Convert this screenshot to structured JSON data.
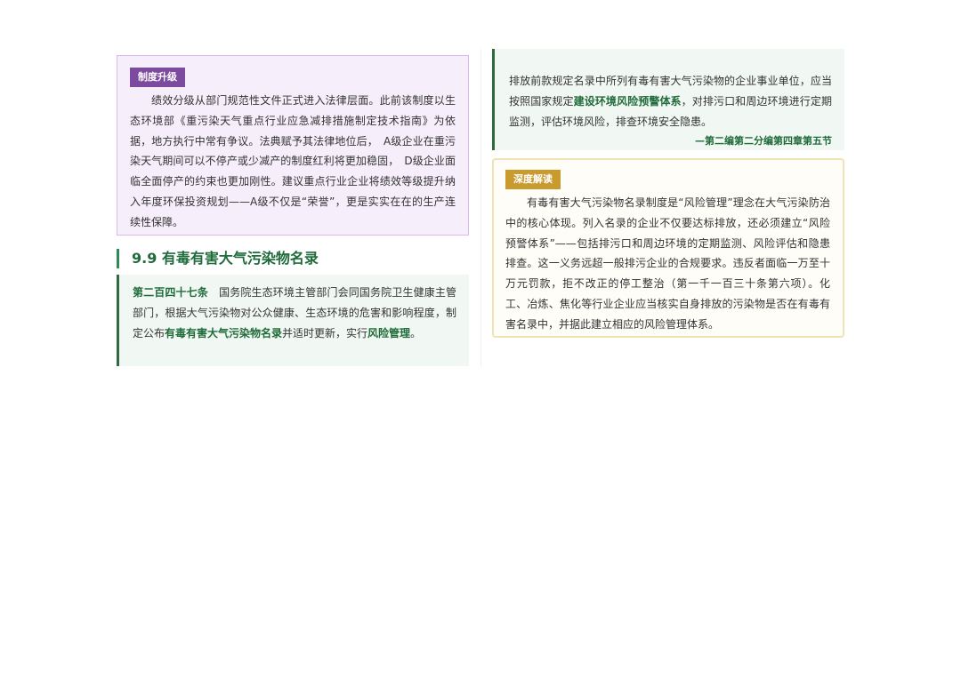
{
  "left": {
    "system_box": {
      "tag": "制度升级",
      "body": "绩效分级从部门规范性文件正式进入法律层面。此前该制度以生态环境部《重污染天气重点行业应急减排措施制定技术指南》为依据，地方执行中常有争议。法典赋予其法律地位后，　A级企业在重污染天气期间可以不停产或少减产的制度红利将更加稳固，　D级企业面临全面停产的约束也更加刚性。建议重点行业企业将绩效等级提升纳入年度环保投资规划——A级不仅是“荣誉”，更是实实在在的生产连续性保障。"
    },
    "section_heading": "9.9 有毒有害大气污染物名录",
    "article": {
      "number": "第二百四十七条",
      "text_before": "　国务院生态环境主管部门会同国务院卫生健康主管部门，根据大气污染物对公众健康、生态环境的危害和影响程度，制定公布",
      "highlight_1": "有毒有害大气污染物名录",
      "text_middle": "并适时更新，实行",
      "highlight_2": "风险管理",
      "text_end": "。"
    }
  },
  "right": {
    "quote": {
      "text_before": "排放前款规定名录中所列有毒有害大气污染物的企业事业单位，应当按照国家规定",
      "highlight": "建设环境风险预警体系",
      "text_after": "，对排污口和周边环境进行定期监测，评估环境风险，排查环境安全隐患。",
      "source": "—第二编第二分编第四章第五节"
    },
    "interpretation": {
      "tag": "深度解读",
      "body": "有毒有害大气污染物名录制度是“风险管理”理念在大气污染防治中的核心体现。列入名录的企业不仅要达标排放，还必须建立“风险预警体系”——包括排污口和周边环境的定期监测、风险评估和隐患排查。这一义务远超一般排污企业的合规要求。违反者面临一万至十万元罚款，拒不改正的停工整治（第一千一百三十条第六项）。化工、冶炼、焦化等行业企业应当核实自身排放的污染物是否在有毒有害名录中，并据此建立相应的风险管理体系。"
    }
  },
  "colors": {
    "purple_tag": "#7c4a9e",
    "purple_bg": "#f6eefb",
    "green_accent": "#1f6b3a",
    "green_bg": "#f1f7f2",
    "gold_tag": "#c99a2e",
    "gold_border": "#f1e2b3"
  }
}
